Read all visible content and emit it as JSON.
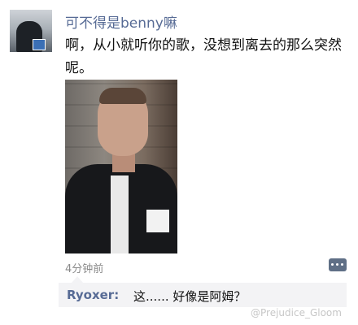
{
  "post": {
    "author": "可不得是benny嘛",
    "text": "啊，从小就听你的歌，没想到离去的那么突然呢。",
    "time": "4分钟前"
  },
  "comment": {
    "author": "Ryoxer:",
    "text": "这...... 好像是阿姆？"
  },
  "watermark": "@Prejudice_Gloom",
  "colors": {
    "name_link": "#576b95",
    "comment_bg": "#f3f3f5",
    "meta_gray": "#8a8a8a"
  },
  "icons": {
    "more_button": "more-dots-icon"
  }
}
